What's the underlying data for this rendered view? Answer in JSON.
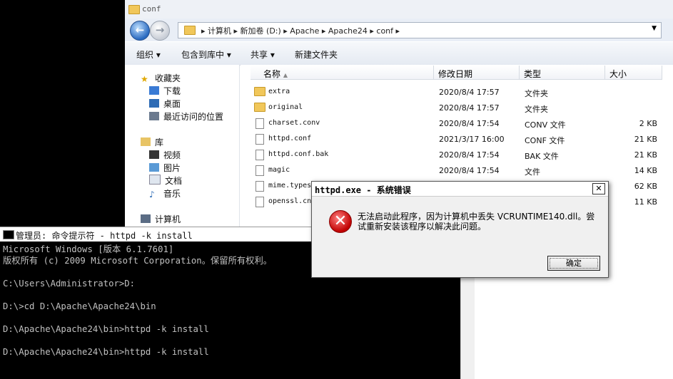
{
  "explorer": {
    "title": "conf",
    "address_crumbs": "▸ 计算机 ▸ 新加卷 (D:) ▸ Apache ▸ Apache24 ▸ conf ▸",
    "toolbar": [
      "组织 ▾",
      "包含到库中 ▾",
      "共享 ▾",
      "新建文件夹"
    ],
    "nav": {
      "favorites": "收藏夹",
      "downloads": "下载",
      "desktop": "桌面",
      "recent": "最近访问的位置",
      "libraries": "库",
      "videos": "视频",
      "pictures": "图片",
      "documents": "文档",
      "music": "音乐",
      "computer": "计算机"
    },
    "columns": {
      "name": "名称",
      "modified": "修改日期",
      "type": "类型",
      "size": "大小"
    },
    "files": [
      {
        "name": "extra",
        "modified": "2020/8/4 17:57",
        "type": "文件夹",
        "size": "",
        "icon": "folder-icon"
      },
      {
        "name": "original",
        "modified": "2020/8/4 17:57",
        "type": "文件夹",
        "size": "",
        "icon": "folder-icon"
      },
      {
        "name": "charset.conv",
        "modified": "2020/8/4 17:54",
        "type": "CONV 文件",
        "size": "2 KB",
        "icon": "file-icon"
      },
      {
        "name": "httpd.conf",
        "modified": "2021/3/17 16:00",
        "type": "CONF 文件",
        "size": "21 KB",
        "icon": "file-icon"
      },
      {
        "name": "httpd.conf.bak",
        "modified": "2020/8/4 17:54",
        "type": "BAK 文件",
        "size": "21 KB",
        "icon": "file-icon"
      },
      {
        "name": "magic",
        "modified": "2020/8/4 17:54",
        "type": "文件",
        "size": "14 KB",
        "icon": "file-icon"
      },
      {
        "name": "mime.types",
        "modified": "",
        "type": "",
        "size": "62 KB",
        "icon": "file-icon"
      },
      {
        "name": "openssl.cn",
        "modified": "",
        "type": "",
        "size": "11 KB",
        "icon": "file-icon"
      }
    ]
  },
  "console": {
    "title": "管理员: 命令提示符 - httpd  -k install",
    "lines": [
      "Microsoft Windows [版本 6.1.7601]",
      "版权所有 (c) 2009 Microsoft Corporation。保留所有权利。",
      "",
      "C:\\Users\\Administrator>D:",
      "",
      "D:\\>cd D:\\Apache\\Apache24\\bin",
      "",
      "D:\\Apache\\Apache24\\bin>httpd -k install",
      "",
      "D:\\Apache\\Apache24\\bin>httpd -k install"
    ]
  },
  "dialog": {
    "title": "httpd.exe - 系统错误",
    "message": "无法启动此程序，因为计算机中丢失 VCRUNTIME140.dll。尝试重新安装该程序以解决此问题。",
    "ok_label": "确定",
    "close_label": "✕"
  }
}
